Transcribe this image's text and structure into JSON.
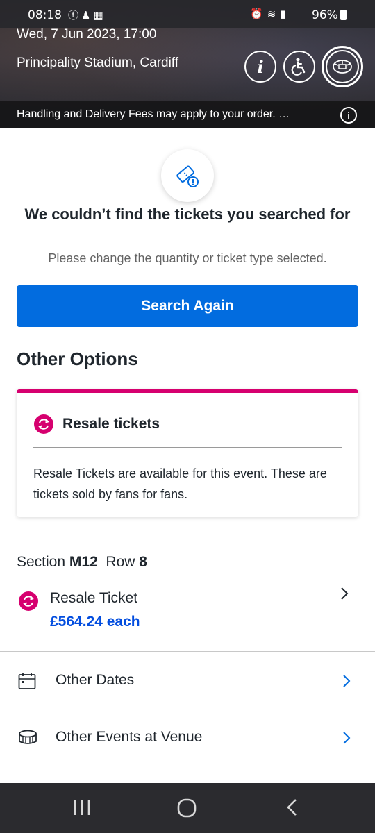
{
  "status_bar": {
    "time": "08:18",
    "battery": "96%",
    "left_icons": [
      "facebook-icon",
      "notification-icon",
      "gallery-icon"
    ],
    "right_icons": [
      "alarm-icon",
      "alarm-clock-icon",
      "wifi-icon",
      "signal-icon",
      "battery-icon"
    ]
  },
  "event": {
    "date": "Wed, 7 Jun 2023, 17:00",
    "venue": "Principality Stadium, Cardiff"
  },
  "header_buttons": {
    "info_label": "i",
    "accessibility_icon": "accessibility-icon",
    "seat_map_icon": "seat-map-icon"
  },
  "fees_notice": "Handling and Delivery Fees may apply to your order. …",
  "empty_state": {
    "icon": "ticket-warning-icon",
    "title": "We couldn’t find the tickets you searched for",
    "subtitle": "Please change the quantity or ticket type selected.",
    "button_label": "Search Again"
  },
  "other_options": {
    "heading": "Other Options",
    "resale_card": {
      "title": "Resale tickets",
      "description": "Resale Tickets are available for this event. These are tickets sold by fans for fans."
    }
  },
  "listing": {
    "section_label": "Section",
    "section_value": "M12",
    "row_label": "Row",
    "row_value": "8",
    "ticket_type": "Resale Ticket",
    "price": "£564.24 each"
  },
  "nav_rows": [
    {
      "label": "Other Dates",
      "icon": "calendar-icon"
    },
    {
      "label": "Other Events at Venue",
      "icon": "stadium-icon"
    }
  ],
  "colors": {
    "primary_blue": "#026cdf",
    "resale_pink": "#d6006f",
    "price_blue": "#024ddf"
  }
}
